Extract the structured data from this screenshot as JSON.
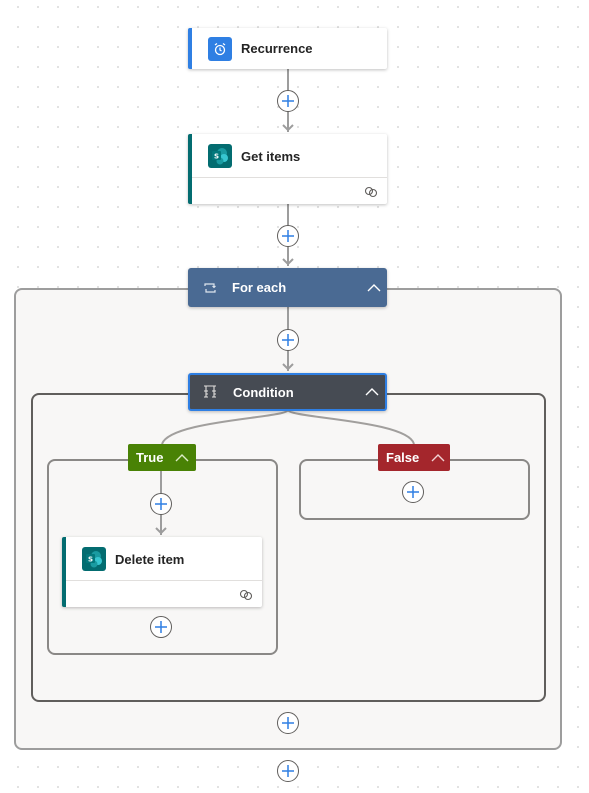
{
  "flow": {
    "recurrence": {
      "title": "Recurrence",
      "icon": "alarm-clock-icon",
      "accent": "#2f7fe3"
    },
    "get_items": {
      "title": "Get items",
      "icon": "sharepoint-icon",
      "footer_icon": "link-icon",
      "accent": "#036c70"
    },
    "for_each": {
      "title": "For each",
      "icon": "loop-icon",
      "color": "#4a6a93",
      "collapse_icon": "chevron-up-icon"
    },
    "condition": {
      "title": "Condition",
      "icon": "condition-icon",
      "color": "#464b53",
      "border": "#2f7fe3",
      "collapse_icon": "chevron-up-icon",
      "true_branch": {
        "label": "True",
        "color": "#498205",
        "actions": [
          {
            "title": "Delete item",
            "icon": "sharepoint-icon",
            "footer_icon": "link-icon",
            "accent": "#036c70"
          }
        ]
      },
      "false_branch": {
        "label": "False",
        "color": "#a4262c",
        "actions": []
      }
    }
  },
  "add_action_icon": "plus-icon"
}
